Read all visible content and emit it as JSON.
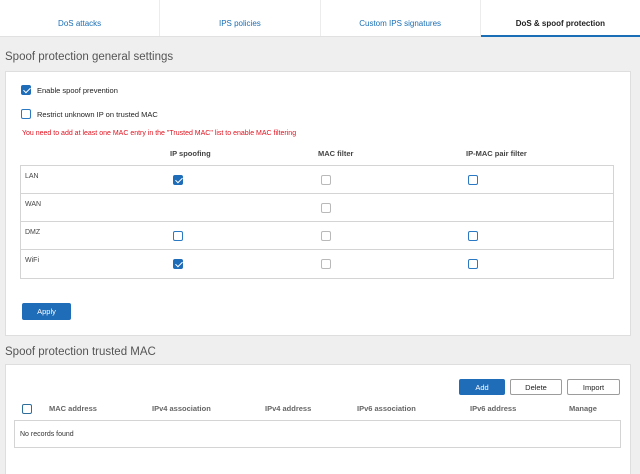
{
  "tabs": [
    {
      "label": "DoS attacks"
    },
    {
      "label": "IPS policies"
    },
    {
      "label": "Custom IPS signatures"
    },
    {
      "label": "DoS & spoof protection",
      "active": true
    }
  ],
  "general": {
    "title": "Spoof protection general settings",
    "enable_spoof": {
      "label": "Enable spoof prevention",
      "checked": true
    },
    "restrict_unknown": {
      "label": "Restrict unknown IP on trusted MAC",
      "checked": false
    },
    "warning": "You need to add at least one MAC entry in the \"Trusted MAC\" list to enable MAC filtering",
    "columns": {
      "ip_spoofing": "IP spoofing",
      "mac_filter": "MAC filter",
      "ip_mac_pair": "IP-MAC pair filter"
    },
    "rows": [
      {
        "zone": "LAN",
        "ip_spoofing": true,
        "mac_filter": false,
        "ip_mac_pair": false
      },
      {
        "zone": "WAN",
        "mac_filter": false
      },
      {
        "zone": "DMZ",
        "ip_spoofing": false,
        "mac_filter": false,
        "ip_mac_pair": false
      },
      {
        "zone": "WiFi",
        "ip_spoofing": true,
        "mac_filter": false,
        "ip_mac_pair": false
      }
    ],
    "apply_label": "Apply"
  },
  "trusted": {
    "title": "Spoof protection trusted MAC",
    "buttons": {
      "add": "Add",
      "delete": "Delete",
      "import": "Import"
    },
    "columns": {
      "mac_address": "MAC address",
      "ipv4_association": "IPv4 association",
      "ipv4_address": "IPv4 address",
      "ipv6_association": "IPv6 association",
      "ipv6_address": "IPv6 address",
      "manage": "Manage"
    },
    "empty_text": "No records found"
  },
  "colors": {
    "accent": "#1f6cb8",
    "warning": "#e0121f",
    "link": "#1a6eb5"
  }
}
